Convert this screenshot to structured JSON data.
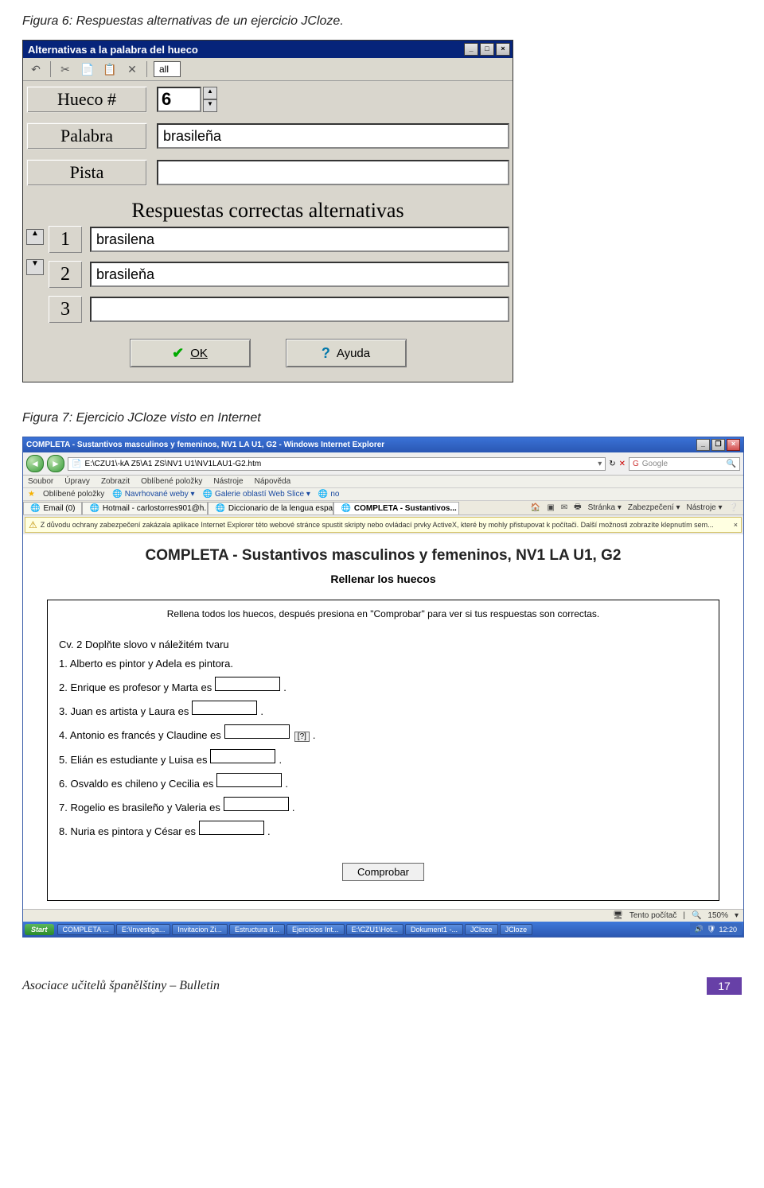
{
  "caption6": "Figura 6: Respuestas alternativas de un ejercicio JCloze.",
  "caption7": "Figura 7: Ejercicio JCloze visto en Internet",
  "win6": {
    "title": "Alternativas a la palabra del hueco",
    "toolbar_all": "all",
    "labels": {
      "hueco": "Hueco #",
      "palabra": "Palabra",
      "pista": "Pista"
    },
    "hueco_value": "6",
    "palabra_value": "brasileña",
    "pista_value": "",
    "section": "Respuestas correctas alternativas",
    "alts": [
      {
        "idx": "1",
        "value": "brasilena"
      },
      {
        "idx": "2",
        "value": "brasileňa"
      },
      {
        "idx": "3",
        "value": ""
      }
    ],
    "ok": "OK",
    "ayuda": "Ayuda"
  },
  "win7": {
    "title": "COMPLETA - Sustantivos masculinos y femeninos, NV1 LA U1, G2 - Windows Internet Explorer",
    "address": "E:\\CZU1\\-kA Z5\\A1 ZS\\NV1 U1\\NV1LAU1-G2.htm",
    "search_placeholder": "Google",
    "menus": [
      "Soubor",
      "Úpravy",
      "Zobrazit",
      "Oblíbené položky",
      "Nástroje",
      "Nápověda"
    ],
    "fav_label": "Oblíbené položky",
    "fav_links": [
      "Navrhované weby ▾",
      "Galerie oblastí Web Slice ▾",
      "no"
    ],
    "tabs": [
      {
        "label": "Email (0)"
      },
      {
        "label": "Hotmail - carlostorres901@h..."
      },
      {
        "label": "Diccionario de la lengua espa..."
      },
      {
        "label": "COMPLETA - Sustantivos...",
        "active": true
      }
    ],
    "tabtools": [
      "Stránka ▾",
      "Zabezpečení ▾",
      "Nástroje ▾"
    ],
    "infobar": "Z důvodu ochrany zabezpečení zakázala aplikace Internet Explorer této webové stránce spustit skripty nebo ovládací prvky ActiveX, které by mohly přistupovat k počítači. Další možnosti zobrazíte klepnutím sem...",
    "page": {
      "title": "COMPLETA - Sustantivos masculinos y femeninos, NV1 LA U1, G2",
      "subtitle": "Rellenar los huecos",
      "instructions": "Rellena todos los huecos, después presiona en \"Comprobar\" para ver si tus respuestas son correctas.",
      "heading_cv": "Cv. 2 Doplňte slovo v náležitém tvaru",
      "items": [
        "1. Alberto es pintor y Adela es pintora.",
        "2. Enrique es profesor y Marta es",
        "3. Juan es artista y Laura es",
        "4. Antonio es francés y Claudine es",
        "5. Elián es estudiante y Luisa es",
        "6. Osvaldo es chileno y Cecilia es",
        "7. Rogelio es brasileño y Valeria es",
        "8. Nuria es pintora y César es"
      ],
      "hint_label": "[?]",
      "check_label": "Comprobar"
    },
    "status": {
      "left": "",
      "center": "Tento počítač",
      "zoom": "150%"
    },
    "taskbar": {
      "start": "Start",
      "tasks": [
        "COMPLETA ...",
        "E:\\Investiga...",
        "Invitacion Zi...",
        "Estructura d...",
        "Ejercicios Int...",
        "E:\\CZU1\\Hot...",
        "Dokument1 -...",
        "JCloze",
        "JCloze"
      ],
      "clock": "12:20"
    }
  },
  "footer": {
    "left": "Asociace učitelů španělštiny – Bulletin",
    "page": "17"
  }
}
